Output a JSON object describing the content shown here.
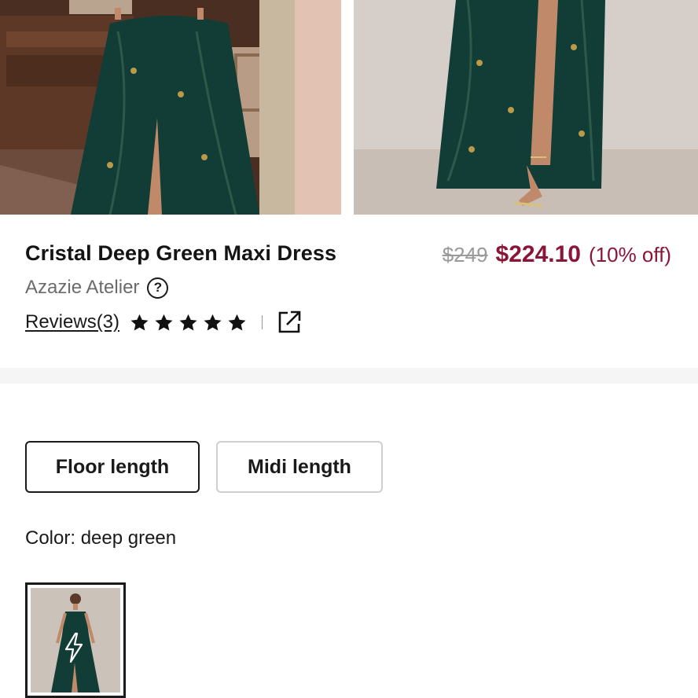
{
  "product": {
    "title": "Cristal Deep Green Maxi Dress",
    "brand": "Azazie Atelier",
    "price_original": "$249",
    "price_sale": "$224.10",
    "price_discount": "(10% off)",
    "reviews_label": "Reviews(3)",
    "rating": 5,
    "rating_max": 5
  },
  "options": {
    "lengths": [
      "Floor length",
      "Midi length"
    ],
    "selected_length": "Floor length",
    "color_label": "Color: deep green"
  },
  "colors": {
    "sale_price": "#8a1538",
    "text": "#1a1a1a",
    "muted": "#6b6b6b",
    "dress": "#123d36"
  },
  "icons": {
    "help": "help-circle-icon",
    "star": "star-icon",
    "share": "external-link-icon",
    "swatch_badge": "lightning-bolt-icon"
  }
}
